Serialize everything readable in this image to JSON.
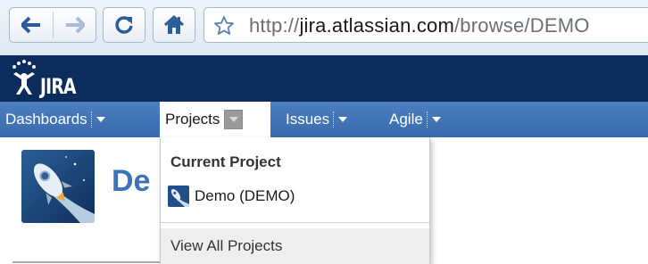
{
  "browser": {
    "back_icon": "arrow-left-icon",
    "forward_icon": "arrow-right-icon",
    "reload_icon": "reload-icon",
    "home_icon": "home-icon",
    "bookmark_icon": "star-icon",
    "url_prefix": "http://",
    "url_host": "jira.atlassian.com",
    "url_path": "/browse/DEMO"
  },
  "app": {
    "logo_text": "JIRA",
    "header_color": "#0b2c5c",
    "menubar_color": "#3e72b4"
  },
  "menu": {
    "items": [
      {
        "label": "Dashboards"
      },
      {
        "label": "Projects"
      },
      {
        "label": "Issues"
      },
      {
        "label": "Agile"
      }
    ],
    "active": "Projects"
  },
  "page": {
    "project_title": "De",
    "title_color": "#3b73b9"
  },
  "dropdown": {
    "heading": "Current Project",
    "current_project": "Demo (DEMO)",
    "footer_link": "View All Projects"
  }
}
